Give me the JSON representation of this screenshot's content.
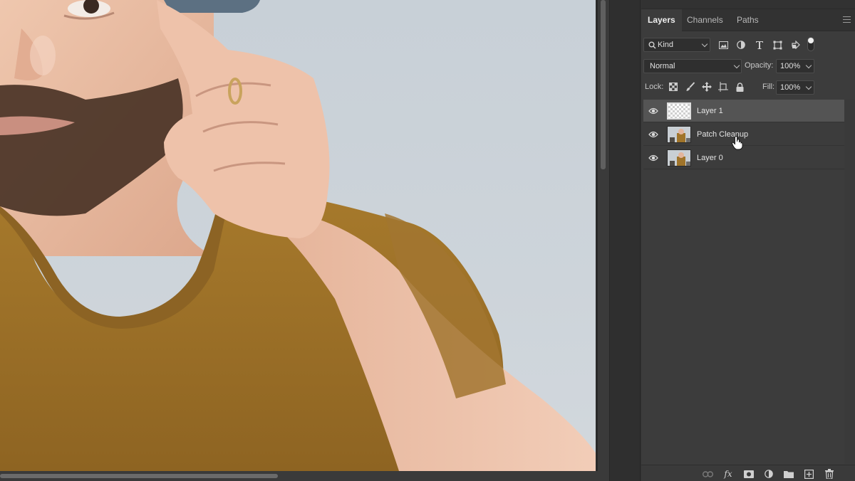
{
  "canvas": {
    "description_icon": "photo-canvas",
    "colors": {
      "background": "#cdd4da",
      "shirt": "#a0742a",
      "skin": "#e8bea6"
    }
  },
  "layers_panel": {
    "tabs": [
      {
        "label": "Layers",
        "active": true
      },
      {
        "label": "Channels",
        "active": false
      },
      {
        "label": "Paths",
        "active": false
      }
    ],
    "filter": {
      "value": "Kind",
      "icons": [
        "image-filter-icon",
        "adjustment-filter-icon",
        "type-filter-icon",
        "shape-filter-icon",
        "smart-object-filter-icon",
        "filter-toggle-icon"
      ]
    },
    "blend_mode": {
      "value": "Normal"
    },
    "opacity": {
      "label": "Opacity:",
      "value": "100%"
    },
    "lock": {
      "label": "Lock:",
      "icons": [
        "lock-transparent-pixels-icon",
        "lock-image-pixels-icon",
        "lock-position-icon",
        "lock-artboard-icon",
        "lock-all-icon"
      ]
    },
    "fill": {
      "label": "Fill:",
      "value": "100%"
    },
    "layers": [
      {
        "name": "Layer 1",
        "selected": true,
        "visible": true,
        "thumbnail": "transparent"
      },
      {
        "name": "Patch Cleanup",
        "selected": false,
        "visible": true,
        "thumbnail": "photo"
      },
      {
        "name": "Layer 0",
        "selected": false,
        "visible": true,
        "thumbnail": "photo"
      }
    ],
    "bottom_icons": [
      "link-layers-icon",
      "fx-icon",
      "add-mask-icon",
      "adjustment-layer-icon",
      "group-folder-icon",
      "new-layer-icon",
      "delete-layer-icon"
    ],
    "bottom_fx_label": "fx",
    "accent": "#545454"
  }
}
